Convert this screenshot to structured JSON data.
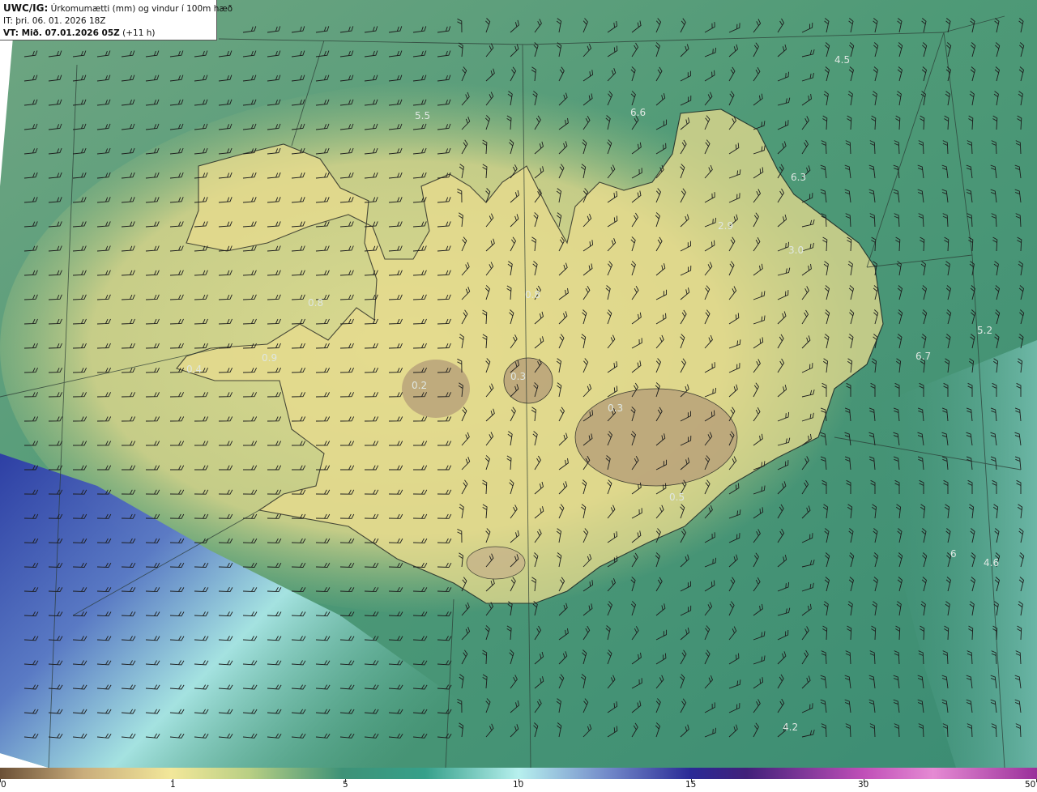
{
  "header": {
    "line1_bold": "UWC/IG:",
    "line1_rest": " Úrkomumætti (mm) og vindur í 100m hæð",
    "line2": "IT: þri. 06. 01. 2026 18Z",
    "line3_bold": "VT: Mið. 07.01.2026 05Z",
    "line3_rest": " (+11 h)"
  },
  "map_labels": [
    "4.5",
    "5.5",
    "6.6",
    "6.3",
    "2.9",
    "3.0",
    "0.8",
    "0.3",
    "0.2",
    "0.3",
    "0.9",
    "0.4",
    "0.8",
    "5.2",
    "6.7",
    "4.6",
    "4.2",
    "6",
    "0.5"
  ],
  "colorbar": {
    "ticks": [
      "0",
      "1",
      "5",
      "10",
      "15",
      "30",
      "50"
    ]
  }
}
